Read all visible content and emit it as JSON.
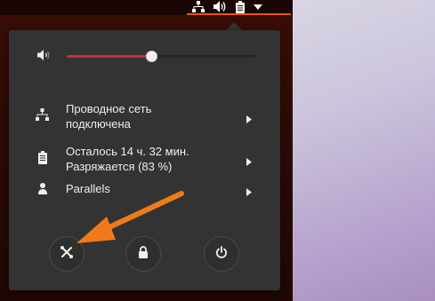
{
  "panel": {
    "icons": [
      "network-icon",
      "speaker-icon",
      "battery-icon",
      "dropdown-arrow-icon"
    ]
  },
  "volume": {
    "level": 0.45,
    "icon": "speaker-low-icon"
  },
  "menu": {
    "network": {
      "line1": "Проводное сеть",
      "line2": "подключена",
      "icon": "network-icon"
    },
    "battery": {
      "line1": "Осталось 14 ч. 32 мин.",
      "line2": "Разряжается (83 %)",
      "icon": "battery-icon"
    },
    "user": {
      "label": "Parallels",
      "icon": "user-icon"
    }
  },
  "actions": [
    "settings-icon",
    "lock-icon",
    "power-icon"
  ],
  "colors": {
    "accent": "#e95420",
    "arrow": "#f07a1a",
    "slider_fill": "#d12c2c",
    "menu_bg": "#333333"
  }
}
